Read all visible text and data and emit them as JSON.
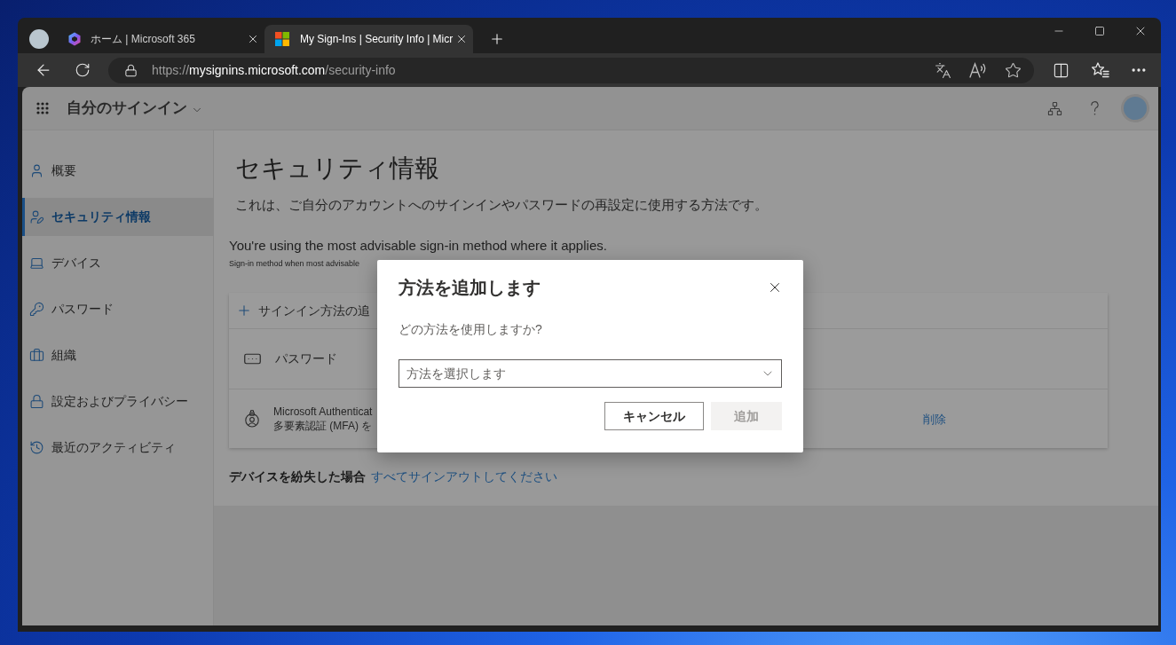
{
  "browser": {
    "tabs": [
      {
        "title": "ホーム | Microsoft 365",
        "selected": false
      },
      {
        "title": "My Sign-Ins | Security Info | Micr",
        "selected": true
      }
    ],
    "address_bar": {
      "scheme": "https://",
      "host": "mysignins.microsoft.com",
      "path": "/security-info"
    }
  },
  "app_header": {
    "title": "自分のサインイン"
  },
  "sidebar": {
    "items": [
      {
        "label": "概要",
        "selected": false
      },
      {
        "label": "セキュリティ情報",
        "selected": true
      },
      {
        "label": "デバイス",
        "selected": false
      },
      {
        "label": "パスワード",
        "selected": false
      },
      {
        "label": "組織",
        "selected": false
      },
      {
        "label": "設定およびプライバシー",
        "selected": false
      },
      {
        "label": "最近のアクティビティ",
        "selected": false
      }
    ]
  },
  "page": {
    "title": "セキュリティ情報",
    "description": "これは、ご自分のアカウントへのサインインやパスワードの再設定に使用する方法です。",
    "default_method_note": "You're using the most advisable sign-in method where it applies.",
    "default_method_detail": "Sign-in method when most advisable",
    "methods": {
      "add_label": "サインイン方法の追",
      "rows": [
        {
          "kind": "password",
          "name": "パスワード"
        },
        {
          "kind": "authenticator",
          "name": "Microsoft Authenticat",
          "detail": "多要素認証 (MFA) を",
          "action": "削除"
        }
      ]
    },
    "lost_device": {
      "label": "デバイスを紛失した場合",
      "link": "すべてサインアウトしてください"
    }
  },
  "dialog": {
    "title": "方法を追加します",
    "question": "どの方法を使用しますか?",
    "select": {
      "placeholder": "方法を選択します"
    },
    "buttons": [
      {
        "label": "キャンセル",
        "disabled": false
      },
      {
        "label": "追加",
        "disabled": true
      }
    ]
  }
}
